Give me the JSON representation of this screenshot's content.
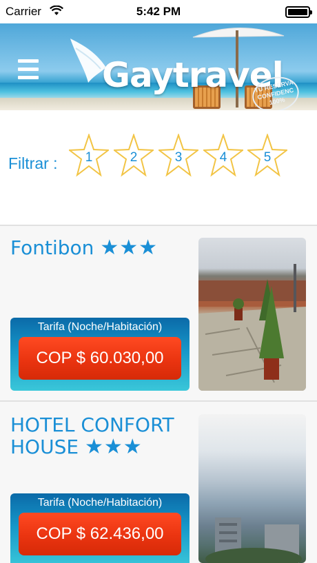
{
  "status_bar": {
    "carrier": "Carrier",
    "time": "5:42 PM"
  },
  "header": {
    "logo_text": "Gaytravel",
    "stamp_text": "TU RESERVA CONFIDENC 100%"
  },
  "filter": {
    "label": "Filtrar :",
    "stars": [
      "1",
      "2",
      "3",
      "4",
      "5"
    ],
    "star_color": "#f2c445"
  },
  "hotels": [
    {
      "name": "Fontibon",
      "stars": "★★★",
      "rate_label": "Tarifa (Noche/Habitación)",
      "price": "COP $ 60.030,00"
    },
    {
      "name_line1": "HOTEL CONFORT",
      "name_line2": "HOUSE",
      "stars": "★★★",
      "rate_label": "Tarifa (Noche/Habitación)",
      "price": "COP $ 62.436,00"
    }
  ],
  "colors": {
    "accent": "#1a8fd6",
    "price_button": "#e8330e",
    "rate_box": "#1697c9"
  },
  "icons": [
    "wifi-icon",
    "battery-icon",
    "menu-icon",
    "star-icon"
  ]
}
